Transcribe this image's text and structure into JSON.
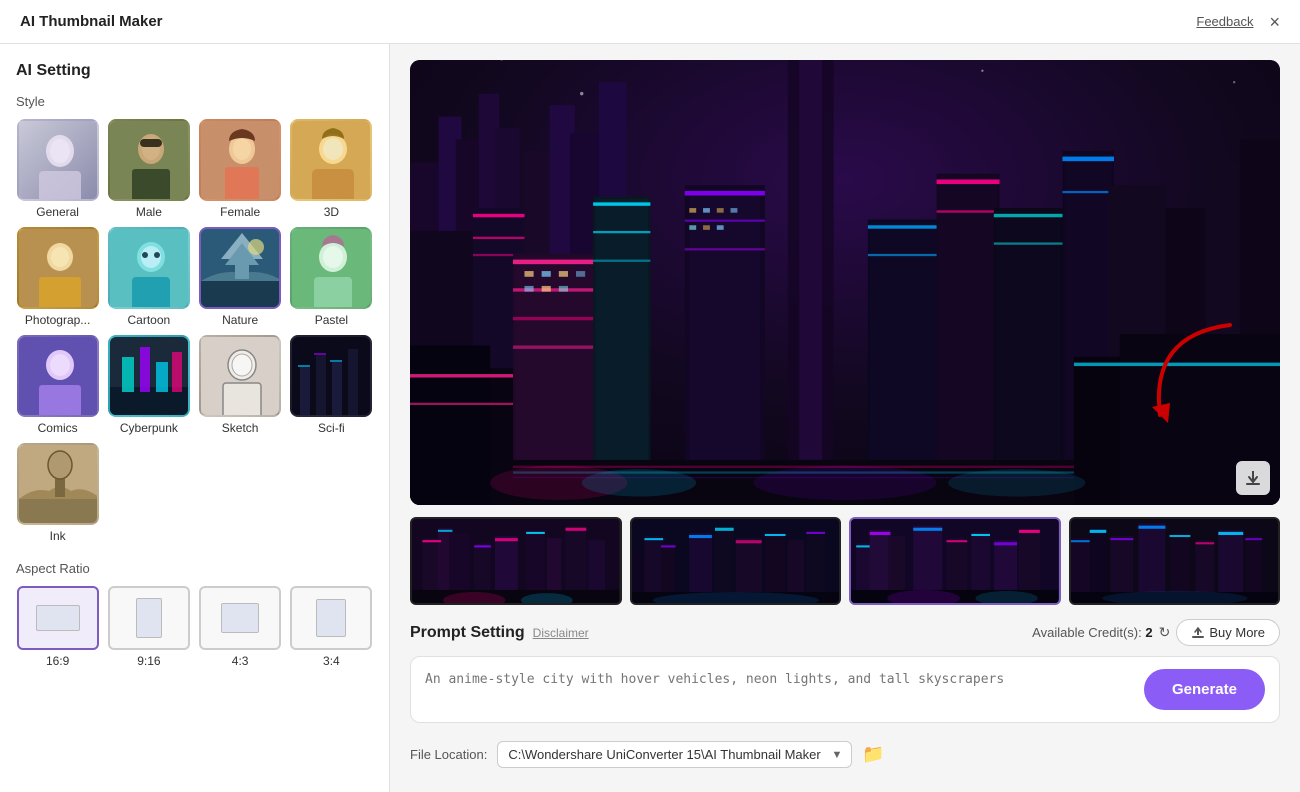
{
  "titleBar": {
    "title": "AI Thumbnail Maker",
    "feedbackLabel": "Feedback",
    "closeLabel": "×"
  },
  "sidebar": {
    "sectionTitle": "AI Setting",
    "styleLabel": "Style",
    "styles": [
      {
        "id": "general",
        "label": "General",
        "thumb": "thumb-general",
        "selected": false
      },
      {
        "id": "male",
        "label": "Male",
        "thumb": "thumb-male",
        "selected": false
      },
      {
        "id": "female",
        "label": "Female",
        "thumb": "thumb-female",
        "selected": false
      },
      {
        "id": "3d",
        "label": "3D",
        "thumb": "thumb-3d",
        "selected": false
      },
      {
        "id": "photography",
        "label": "Photograp...",
        "thumb": "thumb-photo",
        "selected": false
      },
      {
        "id": "cartoon",
        "label": "Cartoon",
        "thumb": "thumb-cartoon",
        "selected": false
      },
      {
        "id": "nature",
        "label": "Nature",
        "thumb": "thumb-nature",
        "selected": true
      },
      {
        "id": "pastel",
        "label": "Pastel",
        "thumb": "thumb-pastel",
        "selected": false
      },
      {
        "id": "comics",
        "label": "Comics",
        "thumb": "thumb-comics",
        "selected": false
      },
      {
        "id": "cyberpunk",
        "label": "Cyberpunk",
        "thumb": "thumb-cyberpunk",
        "selected": false
      },
      {
        "id": "sketch",
        "label": "Sketch",
        "thumb": "thumb-sketch",
        "selected": false
      },
      {
        "id": "scifi",
        "label": "Sci-fi",
        "thumb": "thumb-scifi",
        "selected": false
      },
      {
        "id": "ink",
        "label": "Ink",
        "thumb": "thumb-ink",
        "selected": false
      }
    ],
    "aspectRatioLabel": "Aspect Ratio",
    "aspectRatios": [
      {
        "id": "16-9",
        "label": "16:9",
        "selected": true,
        "innerClass": "aspect-inner-16-9"
      },
      {
        "id": "9-16",
        "label": "9:16",
        "selected": false,
        "innerClass": "aspect-inner-9-16"
      },
      {
        "id": "4-3",
        "label": "4:3",
        "selected": false,
        "innerClass": "aspect-inner-4-3"
      },
      {
        "id": "3-4",
        "label": "3:4",
        "selected": false,
        "innerClass": "aspect-inner-3-4"
      }
    ]
  },
  "mainPanel": {
    "promptSection": {
      "title": "Prompt Setting",
      "disclaimerLabel": "Disclaimer",
      "creditsLabel": "Available Credit(s):",
      "creditsValue": "2",
      "buyMoreLabel": "Buy More",
      "generateLabel": "Generate",
      "promptPlaceholder": "An anime-style city with hover vehicles, neon lights, and tall skyscrapers"
    },
    "fileLocation": {
      "label": "File Location:",
      "path": "C:\\Wondershare UniConverter 15\\AI Thumbnail Maker"
    }
  }
}
